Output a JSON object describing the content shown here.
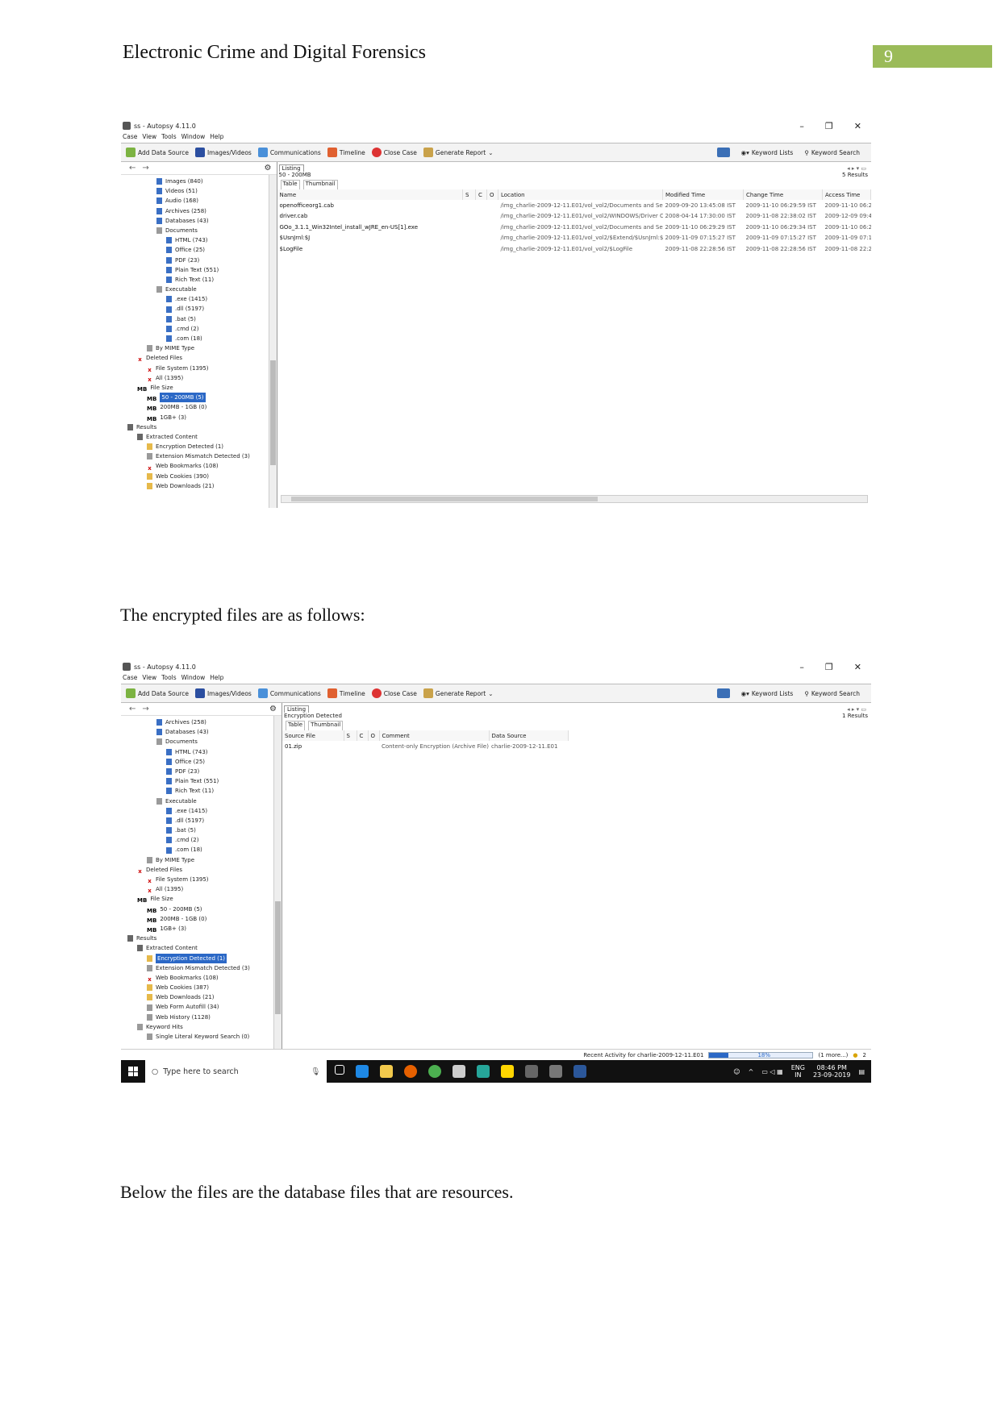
{
  "doc": {
    "header": "Electronic Crime and Digital Forensics",
    "page_number": "9",
    "para1": "The encrypted files are as follows:",
    "para2": "Below the files are the database files that are resources."
  },
  "app": {
    "title": "ss - Autopsy 4.11.0",
    "menu": [
      "Case",
      "View",
      "Tools",
      "Window",
      "Help"
    ],
    "toolbar": {
      "add_data_source": "Add Data Source",
      "images_videos": "Images/Videos",
      "communications": "Communications",
      "timeline": "Timeline",
      "close_case": "Close Case",
      "generate_report": "Generate Report",
      "keyword_lists": "Keyword Lists",
      "keyword_search": "Keyword Search"
    },
    "tab_listing": "Listing",
    "subtab_table": "Table",
    "subtab_thumbnail": "Thumbnail"
  },
  "shot1": {
    "path": "50 - 200MB",
    "results": "5  Results",
    "tree": [
      {
        "indent": 3,
        "icon": "file",
        "label": "Images (840)"
      },
      {
        "indent": 3,
        "icon": "file",
        "label": "Videos (51)"
      },
      {
        "indent": 3,
        "icon": "file",
        "label": "Audio (168)"
      },
      {
        "indent": 3,
        "icon": "file",
        "label": "Archives (258)"
      },
      {
        "indent": 3,
        "icon": "file",
        "label": "Databases (43)"
      },
      {
        "indent": 3,
        "icon": "folder",
        "label": "Documents"
      },
      {
        "indent": 4,
        "icon": "file",
        "label": "HTML (743)"
      },
      {
        "indent": 4,
        "icon": "file",
        "label": "Office (25)"
      },
      {
        "indent": 4,
        "icon": "file",
        "label": "PDF (23)"
      },
      {
        "indent": 4,
        "icon": "file",
        "label": "Plain Text (551)"
      },
      {
        "indent": 4,
        "icon": "file",
        "label": "Rich Text (11)"
      },
      {
        "indent": 3,
        "icon": "folder",
        "label": "Executable"
      },
      {
        "indent": 4,
        "icon": "file",
        "label": ".exe (1415)"
      },
      {
        "indent": 4,
        "icon": "file",
        "label": ".dll (5197)"
      },
      {
        "indent": 4,
        "icon": "file",
        "label": ".bat (5)"
      },
      {
        "indent": 4,
        "icon": "file",
        "label": ".cmd (2)"
      },
      {
        "indent": 4,
        "icon": "file",
        "label": ".com (18)"
      },
      {
        "indent": 2,
        "icon": "folder",
        "label": "By MIME Type"
      },
      {
        "indent": 1,
        "icon": "del",
        "label": "Deleted Files"
      },
      {
        "indent": 2,
        "icon": "del",
        "label": "File System (1395)"
      },
      {
        "indent": 2,
        "icon": "del",
        "label": "All (1395)"
      },
      {
        "indent": 1,
        "icon": "mb",
        "label": "File Size"
      },
      {
        "indent": 2,
        "icon": "mb",
        "label": "50 - 200MB (5)",
        "selected": true
      },
      {
        "indent": 2,
        "icon": "mb",
        "label": "200MB - 1GB (0)"
      },
      {
        "indent": 2,
        "icon": "mb",
        "label": "1GB+ (3)"
      },
      {
        "indent": 0,
        "icon": "res",
        "label": "Results"
      },
      {
        "indent": 1,
        "icon": "res",
        "label": "Extracted Content"
      },
      {
        "indent": 2,
        "icon": "enc",
        "label": "Encryption Detected (1)"
      },
      {
        "indent": 2,
        "icon": "folder",
        "label": "Extension Mismatch Detected (3)"
      },
      {
        "indent": 2,
        "icon": "del",
        "label": "Web Bookmarks (108)"
      },
      {
        "indent": 2,
        "icon": "enc",
        "label": "Web Cookies (390)"
      },
      {
        "indent": 2,
        "icon": "enc",
        "label": "Web Downloads (21)"
      }
    ],
    "columns": [
      "Name",
      "S",
      "C",
      "O",
      "Location",
      "Modified Time",
      "Change Time",
      "Access Time"
    ],
    "rows": [
      [
        "openofficeorg1.cab",
        "",
        "",
        "",
        "/img_charlie-2009-12-11.E01/vol_vol2/Documents and Sett...",
        "2009-09-20 13:45:08 IST",
        "2009-11-10 06:29:59 IST",
        "2009-11-10 06:2"
      ],
      [
        "driver.cab",
        "",
        "",
        "",
        "/img_charlie-2009-12-11.E01/vol_vol2/WINDOWS/Driver C...",
        "2008-04-14 17:30:00 IST",
        "2009-11-08 22:38:02 IST",
        "2009-12-09 09:4"
      ],
      [
        "GOo_3.1.1_Win32Intel_install_wJRE_en-US[1].exe",
        "",
        "",
        "",
        "/img_charlie-2009-12-11.E01/vol_vol2/Documents and Sett...",
        "2009-11-10 06:29:29 IST",
        "2009-11-10 06:29:34 IST",
        "2009-11-10 06:2"
      ],
      [
        "$UsnJrnl:$J",
        "",
        "",
        "",
        "/img_charlie-2009-12-11.E01/vol_vol2/$Extend/$UsnJrnl:$J",
        "2009-11-09 07:15:27 IST",
        "2009-11-09 07:15:27 IST",
        "2009-11-09 07:1"
      ],
      [
        "$LogFile",
        "",
        "",
        "",
        "/img_charlie-2009-12-11.E01/vol_vol2/$LogFile",
        "2009-11-08 22:28:56 IST",
        "2009-11-08 22:28:56 IST",
        "2009-11-08 22:2"
      ]
    ]
  },
  "shot2": {
    "path": "Encryption Detected",
    "results": "1  Results",
    "tree": [
      {
        "indent": 3,
        "icon": "file",
        "label": "Archives (258)"
      },
      {
        "indent": 3,
        "icon": "file",
        "label": "Databases (43)"
      },
      {
        "indent": 3,
        "icon": "folder",
        "label": "Documents"
      },
      {
        "indent": 4,
        "icon": "file",
        "label": "HTML (743)"
      },
      {
        "indent": 4,
        "icon": "file",
        "label": "Office (25)"
      },
      {
        "indent": 4,
        "icon": "file",
        "label": "PDF (23)"
      },
      {
        "indent": 4,
        "icon": "file",
        "label": "Plain Text (551)"
      },
      {
        "indent": 4,
        "icon": "file",
        "label": "Rich Text (11)"
      },
      {
        "indent": 3,
        "icon": "folder",
        "label": "Executable"
      },
      {
        "indent": 4,
        "icon": "file",
        "label": ".exe (1415)"
      },
      {
        "indent": 4,
        "icon": "file",
        "label": ".dll (5197)"
      },
      {
        "indent": 4,
        "icon": "file",
        "label": ".bat (5)"
      },
      {
        "indent": 4,
        "icon": "file",
        "label": ".cmd (2)"
      },
      {
        "indent": 4,
        "icon": "file",
        "label": ".com (18)"
      },
      {
        "indent": 2,
        "icon": "folder",
        "label": "By MIME Type"
      },
      {
        "indent": 1,
        "icon": "del",
        "label": "Deleted Files"
      },
      {
        "indent": 2,
        "icon": "del",
        "label": "File System (1395)"
      },
      {
        "indent": 2,
        "icon": "del",
        "label": "All (1395)"
      },
      {
        "indent": 1,
        "icon": "mb",
        "label": "File Size"
      },
      {
        "indent": 2,
        "icon": "mb",
        "label": "50 - 200MB (5)"
      },
      {
        "indent": 2,
        "icon": "mb",
        "label": "200MB - 1GB (0)"
      },
      {
        "indent": 2,
        "icon": "mb",
        "label": "1GB+ (3)"
      },
      {
        "indent": 0,
        "icon": "res",
        "label": "Results"
      },
      {
        "indent": 1,
        "icon": "res",
        "label": "Extracted Content"
      },
      {
        "indent": 2,
        "icon": "enc",
        "label": "Encryption Detected (1)",
        "selected": true
      },
      {
        "indent": 2,
        "icon": "folder",
        "label": "Extension Mismatch Detected (3)"
      },
      {
        "indent": 2,
        "icon": "del",
        "label": "Web Bookmarks (108)"
      },
      {
        "indent": 2,
        "icon": "enc",
        "label": "Web Cookies (387)"
      },
      {
        "indent": 2,
        "icon": "enc",
        "label": "Web Downloads (21)"
      },
      {
        "indent": 2,
        "icon": "folder",
        "label": "Web Form Autofill (34)"
      },
      {
        "indent": 2,
        "icon": "folder",
        "label": "Web History (1128)"
      },
      {
        "indent": 1,
        "icon": "folder",
        "label": "Keyword Hits"
      },
      {
        "indent": 2,
        "icon": "folder",
        "label": "Single Literal Keyword Search (0)"
      }
    ],
    "columns": [
      "Source File",
      "S",
      "C",
      "O",
      "Comment",
      "Data Source"
    ],
    "rows": [
      [
        "01.zip",
        "",
        "",
        "",
        "Content-only Encryption (Archive File)",
        "charlie-2009-12-11.E01"
      ]
    ],
    "status": {
      "activity": "Recent Activity for charlie-2009-12-11.E01",
      "progress": 0.18,
      "progress_text": "18%",
      "more": "(1 more...)",
      "count": "2"
    },
    "taskbar": {
      "search": "Type here to search",
      "lang1": "ENG",
      "lang2": "IN",
      "time": "08:46 PM",
      "date": "23-09-2019"
    }
  }
}
